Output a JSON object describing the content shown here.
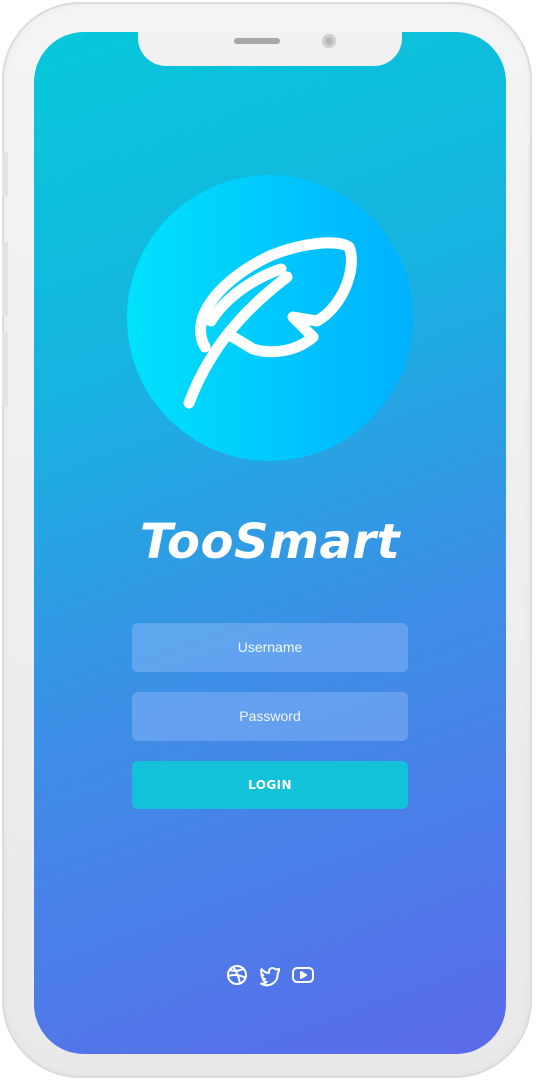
{
  "app": {
    "name": "TooSmart",
    "logo_icon": "feather-icon"
  },
  "login_form": {
    "username_placeholder": "Username",
    "password_placeholder": "Password",
    "login_label": "LOGIN"
  },
  "social": [
    {
      "icon": "dribbble-icon"
    },
    {
      "icon": "twitter-icon"
    },
    {
      "icon": "youtube-icon"
    }
  ],
  "colors": {
    "gradient_top": "#07c8d9",
    "gradient_bottom": "#5b6aea",
    "logo_circle_left": "#00e2fb",
    "logo_circle_right": "#00b0ff",
    "login_button": "#12c2d8",
    "text": "#ffffff"
  }
}
